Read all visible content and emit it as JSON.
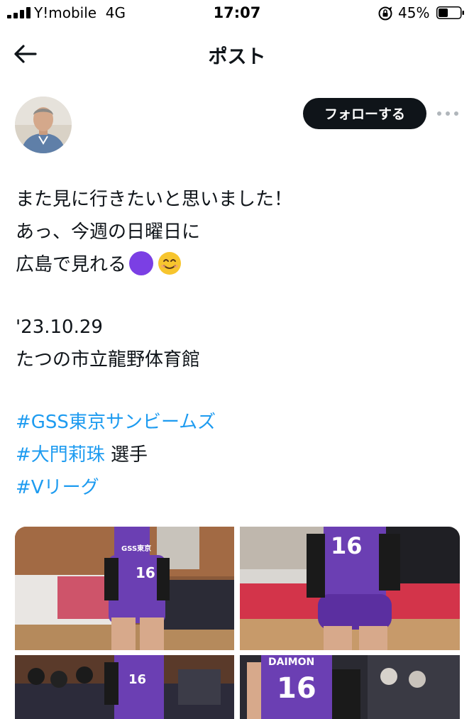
{
  "status_bar": {
    "carrier": "Y!mobile",
    "network": "4G",
    "time": "17:07",
    "battery_percent": "45%",
    "battery_level": 0.45,
    "icons": [
      "signal-icon",
      "orientation-lock-icon",
      "battery-icon"
    ]
  },
  "header": {
    "title": "ポスト",
    "back_icon": "back-arrow-icon"
  },
  "author": {
    "avatar_icon": "avatar",
    "follow_label": "フォローする",
    "more_icon": "more-options-icon"
  },
  "post": {
    "lines": [
      "また見に行きたいと思いました！",
      "あっ、今週の日曜日に",
      "広島で見れる"
    ],
    "emojis": [
      "purple-circle-emoji",
      "smiling-face-emoji"
    ],
    "date": "'23.10.29",
    "venue": "たつの市立龍野体育館",
    "hashtag_1": "#GSS東京サンビームズ",
    "hashtag_2": "#大門莉珠",
    "hashtag_2_suffix": " 選手",
    "hashtag_3": "#Vリーグ"
  },
  "media": {
    "photos": [
      {
        "jersey_text": "GSS東京",
        "number": "16"
      },
      {
        "number": "16"
      },
      {
        "number": "16"
      },
      {
        "jersey_name": "DAIMON",
        "number": "16"
      }
    ],
    "colors": {
      "jersey": "#6b3fb3",
      "court": "#c9a36b",
      "banner": "#e8ecef"
    }
  },
  "colors": {
    "link": "#1d9bf0",
    "text": "#0f1419",
    "follow_button": "#0f1419"
  }
}
